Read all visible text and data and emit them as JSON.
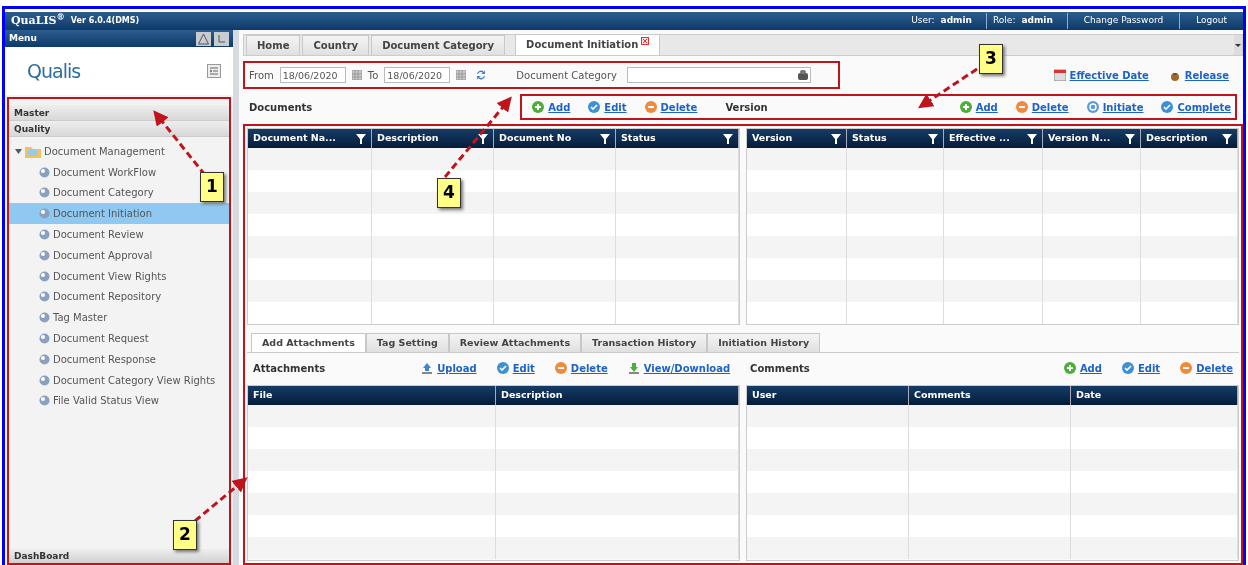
{
  "app": {
    "title": "QuaLIS",
    "title_mark": "®",
    "version": "Ver 6.0.4(DMS)"
  },
  "header": {
    "user_label": "User:",
    "user": "admin",
    "role_label": "Role:",
    "role": "admin",
    "links": [
      "Change Password",
      "Logout"
    ]
  },
  "sidebar": {
    "title": "Menu",
    "logo": "Qualis",
    "sections": [
      "Master",
      "Quality"
    ],
    "tree": [
      {
        "label": "Document Management",
        "expanded": true,
        "children": [
          {
            "label": "Document WorkFlow",
            "selected": false
          },
          {
            "label": "Document Category",
            "selected": false
          },
          {
            "label": "Document Initiation",
            "selected": true
          },
          {
            "label": "Document Review",
            "selected": false
          },
          {
            "label": "Document Approval",
            "selected": false
          },
          {
            "label": "Document View Rights",
            "selected": false
          },
          {
            "label": "Document Repository",
            "selected": false
          },
          {
            "label": "Tag Master",
            "selected": false
          },
          {
            "label": "Document Request",
            "selected": false
          },
          {
            "label": "Document Response",
            "selected": false
          },
          {
            "label": "Document Category View Rights",
            "selected": false
          },
          {
            "label": "File Valid Status View",
            "selected": false
          }
        ]
      }
    ],
    "footer": "DashBoard"
  },
  "tabs": [
    {
      "label": "Home",
      "selected": false,
      "closable": false
    },
    {
      "label": "Country",
      "selected": false,
      "closable": false
    },
    {
      "label": "Document Category",
      "selected": false,
      "closable": false
    },
    {
      "label": "Document Initiation",
      "selected": true,
      "closable": true
    }
  ],
  "filter": {
    "from_label": "From",
    "from": "18/06/2020",
    "to_label": "To",
    "to": "18/06/2020",
    "category_label": "Document Category"
  },
  "links": [
    {
      "label": "Effective Date",
      "kind": "calendar"
    },
    {
      "label": "Release",
      "kind": "bag"
    }
  ],
  "documents": {
    "title": "Documents",
    "actions": [
      {
        "label": "Add",
        "kind": "add"
      },
      {
        "label": "Edit",
        "kind": "edit"
      },
      {
        "label": "Delete",
        "kind": "delete"
      }
    ],
    "columns": [
      "Document Na...",
      "Description",
      "Document No",
      "Status"
    ]
  },
  "version": {
    "title": "Version",
    "actions": [
      {
        "label": "Add",
        "kind": "add"
      },
      {
        "label": "Delete",
        "kind": "delete"
      },
      {
        "label": "Initiate",
        "kind": "initiate"
      },
      {
        "label": "Complete",
        "kind": "edit"
      }
    ],
    "columns": [
      "Version",
      "Status",
      "Effective ...",
      "Version N...",
      "Description"
    ]
  },
  "detail_tabs": [
    {
      "label": "Add Attachments",
      "selected": true
    },
    {
      "label": "Tag Setting",
      "selected": false
    },
    {
      "label": "Review Attachments",
      "selected": false
    },
    {
      "label": "Transaction History",
      "selected": false
    },
    {
      "label": "Initiation History",
      "selected": false
    }
  ],
  "attachments": {
    "title": "Attachments",
    "actions": [
      {
        "label": "Upload",
        "kind": "upload"
      },
      {
        "label": "Edit",
        "kind": "edit"
      },
      {
        "label": "Delete",
        "kind": "delete"
      },
      {
        "label": "View/Download",
        "kind": "download"
      }
    ],
    "columns": [
      "File",
      "Description"
    ]
  },
  "comments": {
    "title": "Comments",
    "actions": [
      {
        "label": "Add",
        "kind": "add"
      },
      {
        "label": "Edit",
        "kind": "edit"
      },
      {
        "label": "Delete",
        "kind": "delete"
      }
    ],
    "columns": [
      "User",
      "Comments",
      "Date"
    ]
  },
  "callouts": [
    "1",
    "2",
    "3",
    "4"
  ]
}
